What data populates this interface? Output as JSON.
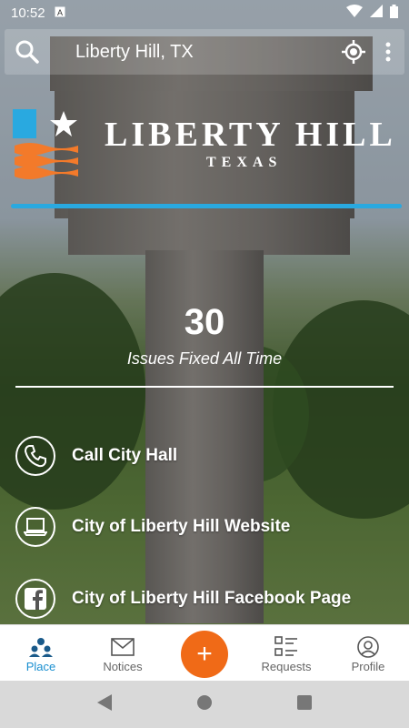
{
  "status": {
    "time": "10:52"
  },
  "search": {
    "place": "Liberty Hill, TX"
  },
  "logo": {
    "wordmark": "LIBERTY HILL",
    "subtitle": "TEXAS"
  },
  "stats": {
    "value": "30",
    "label": "Issues Fixed All Time"
  },
  "links": [
    {
      "label": "Call City Hall",
      "icon": "phone-icon"
    },
    {
      "label": "City of Liberty Hill Website",
      "icon": "laptop-icon"
    },
    {
      "label": "City of Liberty Hill Facebook Page",
      "icon": "facebook-icon"
    }
  ],
  "nav": {
    "place": "Place",
    "notices": "Notices",
    "add": "+",
    "requests": "Requests",
    "profile": "Profile"
  },
  "colors": {
    "accent": "#1a8fd0",
    "fab": "#f06a17",
    "logo_blue": "#29a9e0",
    "logo_orange": "#f37a2a"
  }
}
